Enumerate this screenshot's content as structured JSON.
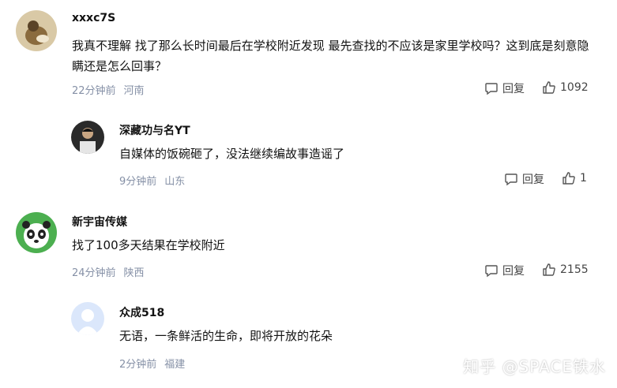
{
  "comments": [
    {
      "author": "xxxc7S",
      "text": "我真不理解 找了那么长时间最后在学校附近发现 最先查找的不应该是家里学校吗？这到底是刻意隐瞒还是怎么回事？",
      "time": "22分钟前",
      "location": "河南",
      "reply_label": "回复",
      "likes": "1092"
    },
    {
      "author": "深藏功与名YT",
      "text": "自媒体的饭碗砸了，没法继续编故事造谣了",
      "time": "9分钟前",
      "location": "山东",
      "reply_label": "回复",
      "likes": "1"
    },
    {
      "author": "新宇宙传媒",
      "text": "找了100多天结果在学校附近",
      "time": "24分钟前",
      "location": "陕西",
      "reply_label": "回复",
      "likes": "2155"
    },
    {
      "author": "众成518",
      "text": "无语，一条鲜活的生命，即将开放的花朵",
      "time": "2分钟前",
      "location": "福建"
    }
  ],
  "watermark": "知乎 @SPACE铁水",
  "colors": {
    "meta": "#8590a6",
    "text": "#121212"
  }
}
